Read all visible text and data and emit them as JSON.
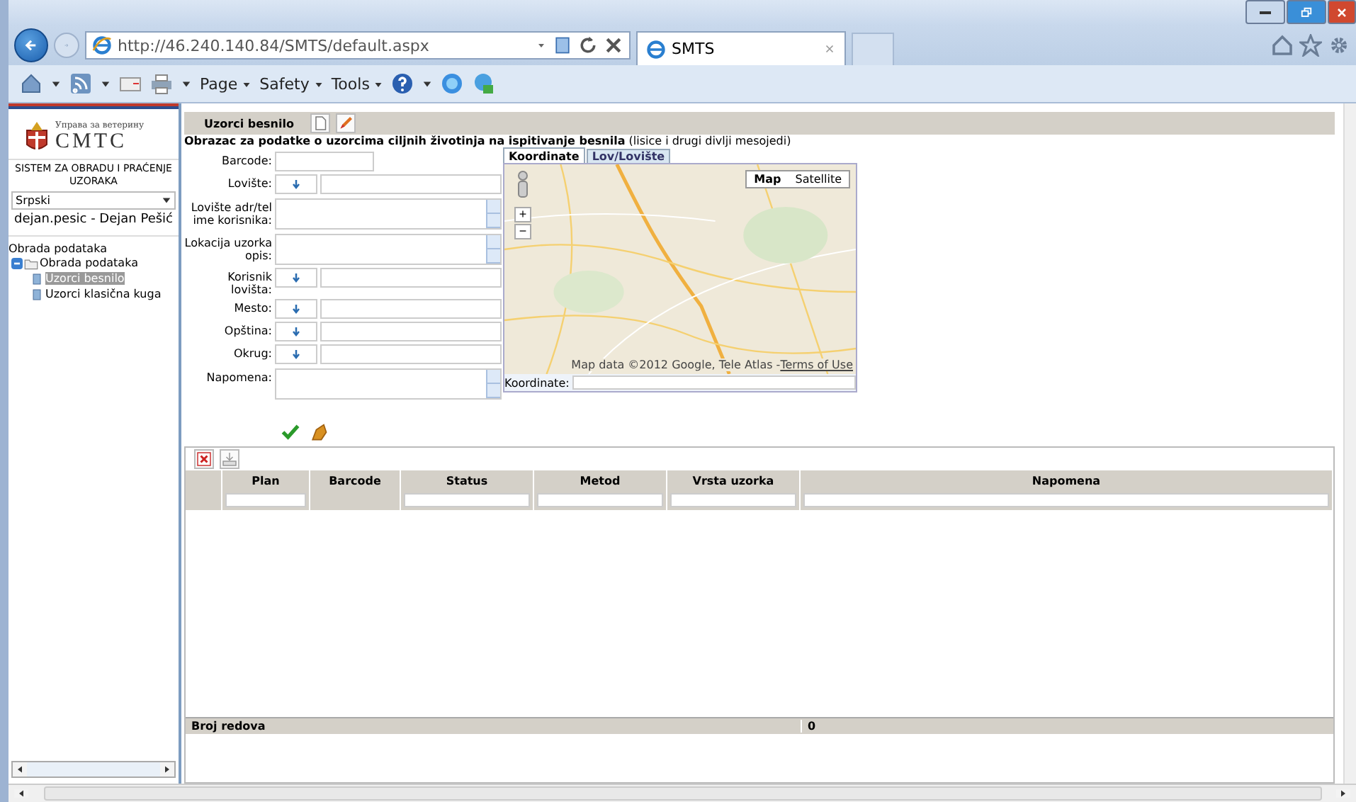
{
  "browser": {
    "url": "http://46.240.140.84/SMTS/default.aspx",
    "tab_title": "SMTS",
    "commands": [
      "Page",
      "Safety",
      "Tools"
    ]
  },
  "sidebar": {
    "org_name": "Управа за ветерину",
    "logo_text": "СМТС",
    "system_name": "SISTEM ZA OBRADU I PRAĆENJE UZORAKA",
    "language": "Srpski",
    "user": "dejan.pesic - Dejan Pešić",
    "section": "Obrada podataka",
    "tree": [
      {
        "label": "Obrada podataka",
        "expanded": true,
        "children": [
          {
            "label": "Uzorci besnilo",
            "selected": true
          },
          {
            "label": "Uzorci klasična kuga",
            "selected": false
          }
        ]
      }
    ]
  },
  "toolbar": {
    "title": "Uzorci besnilo"
  },
  "form": {
    "title": "**Obrazac za podatke o uzorcima ciljnih životinja na ispitivanje besnila** (lisice i drugi divlji mesojedi)",
    "fields": [
      {
        "label": "Barcode:",
        "kind": "text"
      },
      {
        "label": "Lovište:",
        "kind": "lookup"
      },
      {
        "label": "Lovište adr/tel ime korisnika:",
        "kind": "textarea"
      },
      {
        "label": "Lokacija uzorka opis:",
        "kind": "textarea"
      },
      {
        "label": "Korisnik lovišta:",
        "kind": "lookup"
      },
      {
        "label": "Mesto:",
        "kind": "lookup"
      },
      {
        "label": "Opština:",
        "kind": "lookup"
      },
      {
        "label": "Okrug:",
        "kind": "lookup"
      },
      {
        "label": "Napomena:",
        "kind": "textarea"
      }
    ]
  },
  "map_panel": {
    "tabs": [
      {
        "label": "Koordinate",
        "selected": true
      },
      {
        "label": "Lov/Lovište",
        "selected": false
      }
    ],
    "map_types": [
      {
        "label": "Map",
        "selected": true
      },
      {
        "label": "Satellite",
        "selected": false
      }
    ],
    "zoom_controls": [
      "+",
      "−"
    ],
    "attribution": "Map data ©2012 Google, Tele Atlas - ",
    "terms_link": "Terms of Use",
    "coord_label": "Koordinate:"
  },
  "grid": {
    "columns": [
      {
        "label": "Plan",
        "filter": true
      },
      {
        "label": "Barcode",
        "filter": false
      },
      {
        "label": "Status",
        "filter": true
      },
      {
        "label": "Metod",
        "filter": true
      },
      {
        "label": "Vrsta uzorka",
        "filter": true
      },
      {
        "label": "Napomena",
        "filter": true
      }
    ],
    "footer_label": "Broj redova",
    "footer_count": "0"
  }
}
